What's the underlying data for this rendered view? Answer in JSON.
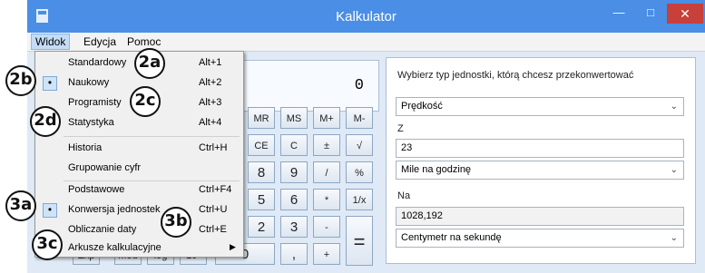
{
  "window": {
    "title": "Kalkulator",
    "minimize": "—",
    "maximize": "□",
    "close": "✕"
  },
  "menubar": {
    "widok": "Widok",
    "edycja": "Edycja",
    "pomoc": "Pomoc"
  },
  "display": {
    "value": "0"
  },
  "keypad": {
    "r1": [
      "MR",
      "MS",
      "M+",
      "M-"
    ],
    "r2": [
      "CE",
      "C",
      "±",
      "√"
    ],
    "r3": [
      "8",
      "9",
      "/",
      "%"
    ],
    "r4": [
      "5",
      "6",
      "*",
      "1/x"
    ],
    "r5": [
      "2",
      "3",
      "-"
    ],
    "equals": "=",
    "r6": [
      ",",
      "+"
    ],
    "bottom_row": [
      "Exp",
      "Mod",
      "log",
      "10ˣ",
      "0"
    ]
  },
  "converter": {
    "prompt": "Wybierz typ jednostki, którą chcesz przekonwertować",
    "unit_type": "Prędkość",
    "from_label": "Z",
    "from_value": "23",
    "from_unit": "Mile na godzinę",
    "to_label": "Na",
    "to_value": "1028,192",
    "to_unit": "Centymetr na sekundę"
  },
  "view_menu": {
    "standard": {
      "label": "Standardowy",
      "shortcut": "Alt+1"
    },
    "scientific": {
      "label": "Naukowy",
      "shortcut": "Alt+2"
    },
    "programmer": {
      "label": "Programisty",
      "shortcut": "Alt+3"
    },
    "statistics": {
      "label": "Statystyka",
      "shortcut": "Alt+4"
    },
    "history": {
      "label": "Historia",
      "shortcut": "Ctrl+H"
    },
    "grouping": {
      "label": "Grupowanie cyfr"
    },
    "basic": {
      "label": "Podstawowe",
      "shortcut": "Ctrl+F4"
    },
    "unit_conversion": {
      "label": "Konwersja jednostek",
      "shortcut": "Ctrl+U"
    },
    "date_calc": {
      "label": "Obliczanie daty",
      "shortcut": "Ctrl+E"
    },
    "worksheets": {
      "label": "Arkusze kalkulacyjne"
    },
    "checkmark": "•",
    "submenu_arrow": "▶"
  },
  "callouts": {
    "c2a": "2a",
    "c2b": "2b",
    "c2c": "2c",
    "c2d": "2d",
    "c3a": "3a",
    "c3b": "3b",
    "c3c": "3c"
  },
  "colors": {
    "titlebar": "#4a8ee6",
    "close": "#c7403a",
    "window": "#dfeaf6"
  }
}
